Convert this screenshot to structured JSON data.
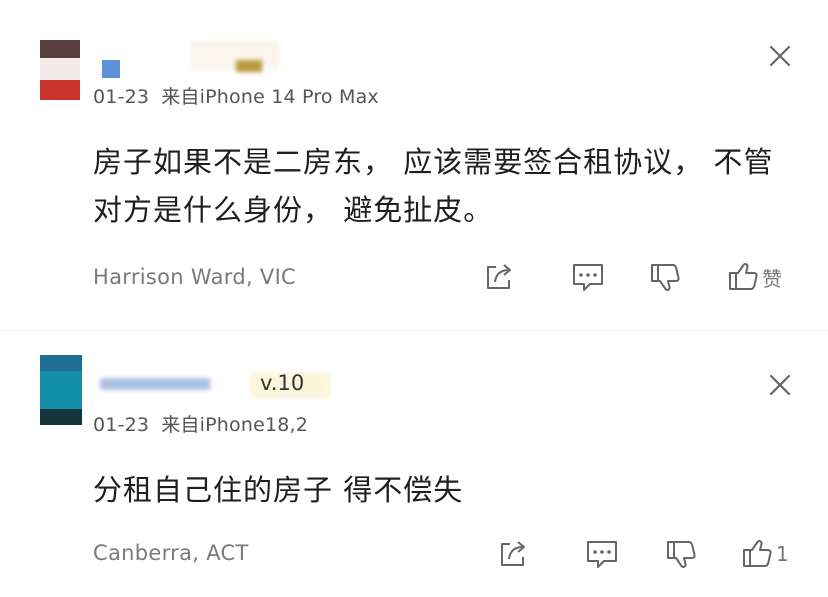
{
  "comments": [
    {
      "date": "01-23",
      "device": "来自iPhone 14 Pro Max",
      "content_line1": "房子如果不是二房东， 应该需要签合租协议， 不管",
      "content_line2": "对方是什么身份， 避免扯皮。",
      "location": "Harrison Ward,  VIC",
      "like_label": "赞"
    },
    {
      "level": "v.10",
      "date": "01-23",
      "device": "来自iPhone18,2",
      "content_line1": "分租自己住的房子 得不偿失",
      "location": "Canberra, ACT",
      "like_label": "1"
    }
  ],
  "icons": {
    "close": "close-icon",
    "share": "share-icon",
    "reply": "reply-icon",
    "dislike": "thumbs-down-icon",
    "like": "thumbs-up-icon"
  },
  "colors": {
    "text": "#1f1f1f",
    "meta": "#555555",
    "icon": "#666666",
    "divider": "#eeeeee"
  }
}
